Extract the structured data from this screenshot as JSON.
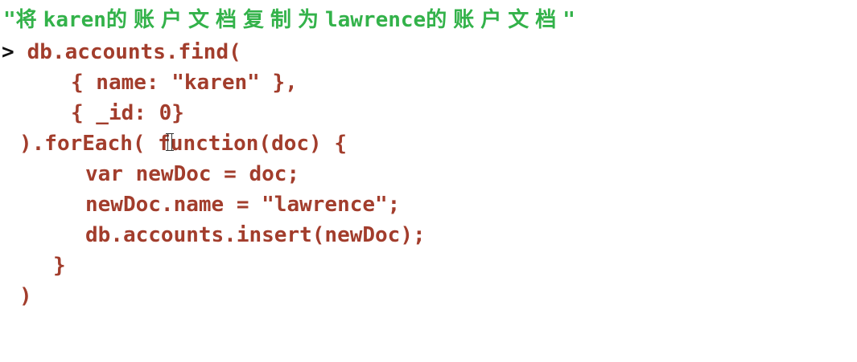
{
  "code": {
    "comment": {
      "quote_open": "\"",
      "cn_1": "将",
      "en_1": "karen",
      "cn_2": "的账户文档复制为",
      "en_2": "lawrence",
      "cn_3": "的账户文档",
      "quote_close": "\""
    },
    "prompt": ">",
    "lines": [
      "db.accounts.find(",
      "{ name: \"karen\" },",
      "{ _id: 0}",
      ").forEach( function(doc) {",
      "var newDoc = doc;",
      "newDoc.name = \"lawrence\";",
      "db.accounts.insert(newDoc);",
      "}",
      ")"
    ]
  },
  "colors": {
    "background": "#ffffff",
    "code_text": "#a23d2c",
    "comment_text": "#33b24a",
    "prompt": "#111111"
  },
  "icons": {
    "cursor": "i-beam-cursor-icon"
  }
}
